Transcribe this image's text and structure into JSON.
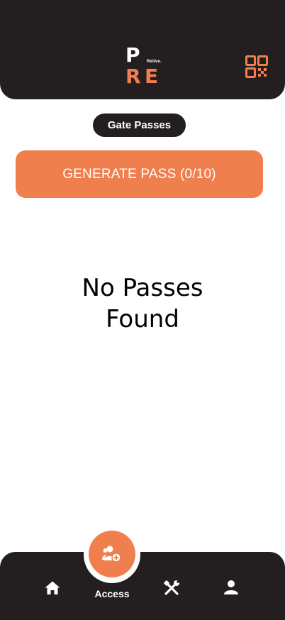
{
  "header": {
    "logo": {
      "letter_top": "P",
      "letters_bottom": [
        "R",
        "E"
      ],
      "tagline": "Relive."
    },
    "qr_icon": "qr-code-icon"
  },
  "section_title": "Gate Passes",
  "generate_button": {
    "label": "GENERATE PASS (0/10)"
  },
  "empty_state": {
    "line1": "No Passes",
    "line2": "Found"
  },
  "bottom_nav": {
    "items": [
      {
        "icon": "home-icon"
      },
      {
        "icon": "access-add-users-icon",
        "label": "Access",
        "active": true
      },
      {
        "icon": "tools-icon"
      },
      {
        "icon": "profile-icon"
      }
    ]
  },
  "colors": {
    "brand": "#f07f4e",
    "dark": "#231f20",
    "white": "#ffffff"
  }
}
